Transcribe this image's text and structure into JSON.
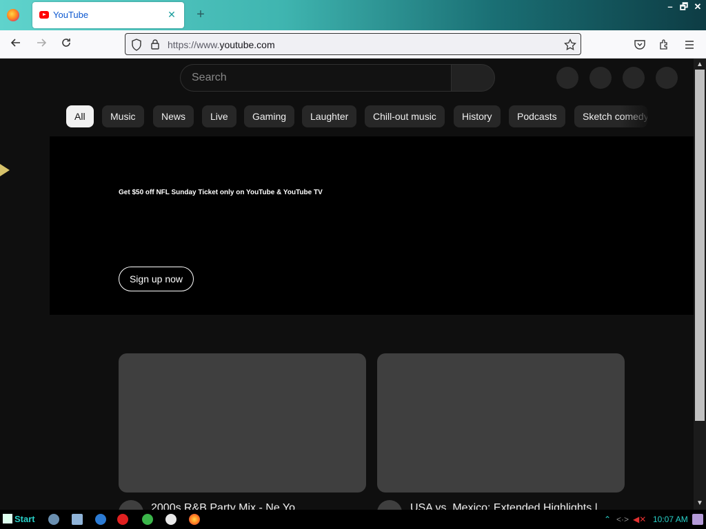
{
  "browser": {
    "tab_title": "YouTube",
    "tab_close": "✕",
    "new_tab": "+",
    "url_scheme": "https://www.",
    "url_host": "youtube.com",
    "window_controls": [
      "–",
      "🗗",
      "✕"
    ]
  },
  "youtube": {
    "search_placeholder": "Search",
    "chips": [
      "All",
      "Music",
      "News",
      "Live",
      "Gaming",
      "Laughter",
      "Chill-out music",
      "History",
      "Podcasts",
      "Sketch comedy"
    ],
    "banner": {
      "headline": "Get $50 off NFL Sunday Ticket only on YouTube & YouTube TV",
      "cta": "Sign up now"
    },
    "videos": [
      {
        "title": "2000s R&B Party Mix - Ne Yo"
      },
      {
        "title": "USA vs. Mexico: Extended Highlights |"
      }
    ]
  },
  "taskbar": {
    "start_label": "Start",
    "clock": "10:07 AM"
  }
}
